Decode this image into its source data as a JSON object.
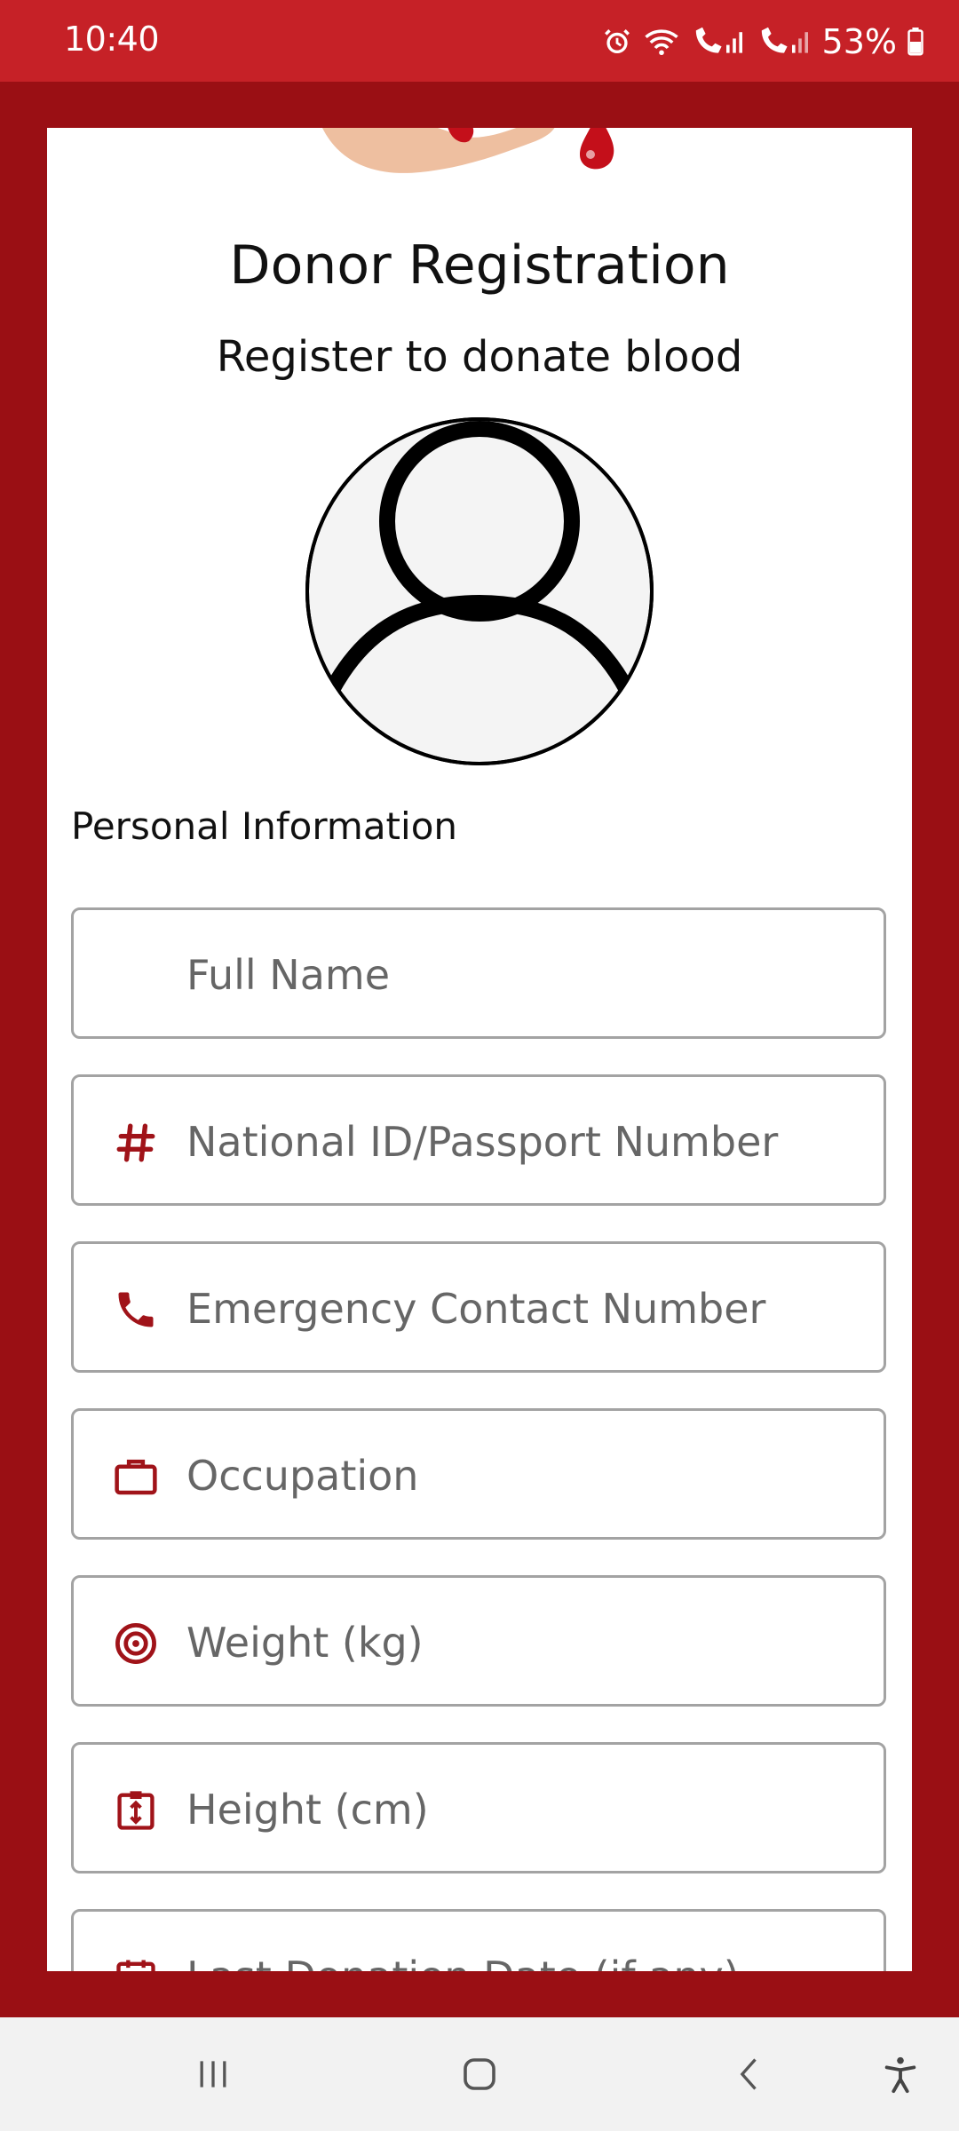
{
  "status_bar": {
    "time": "10:40",
    "battery": "53%"
  },
  "header": {
    "title": "Donor Registration",
    "subtitle": "Register to donate blood"
  },
  "section": {
    "label": "Personal Information"
  },
  "fields": [
    {
      "placeholder": "Full Name",
      "icon": "none"
    },
    {
      "placeholder": "National ID/Passport Number",
      "icon": "hash-icon"
    },
    {
      "placeholder": "Emergency Contact Number",
      "icon": "phone-icon"
    },
    {
      "placeholder": "Occupation",
      "icon": "briefcase-icon"
    },
    {
      "placeholder": "Weight (kg)",
      "icon": "target-icon"
    },
    {
      "placeholder": "Height (cm)",
      "icon": "height-icon"
    },
    {
      "placeholder": "Last Donation Date (if any)",
      "icon": "calendar-icon"
    }
  ],
  "colors": {
    "brand_red": "#9a0f14",
    "status_red": "#c62127",
    "icon_red": "#a01319",
    "border_gray": "#a3a3a3"
  }
}
